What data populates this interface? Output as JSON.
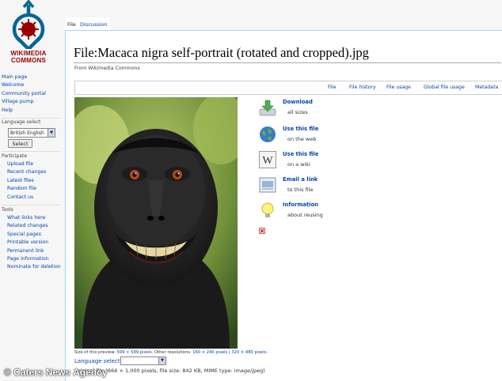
{
  "site": {
    "wordmark_line1": "WIKIMEDIA",
    "wordmark_line2": "COMMONS"
  },
  "sidebar": {
    "nav": [
      "Main page",
      "Welcome",
      "Community portal",
      "Village pump",
      "Help"
    ],
    "language": {
      "heading": "Language select",
      "selected": "British English",
      "button": "Select"
    },
    "participate": {
      "heading": "Participate",
      "items": [
        "Upload file",
        "Recent changes",
        "Latest files",
        "Random file",
        "Contact us"
      ]
    },
    "tools": {
      "heading": "Tools",
      "items": [
        "What links here",
        "Related changes",
        "Special pages",
        "Printable version",
        "Permanent link",
        "Page information",
        "Nominate for deletion"
      ]
    }
  },
  "tabs": {
    "file": "File",
    "discussion": "Discussion"
  },
  "page": {
    "title": "File:Macaca nigra self-portrait (rotated and cropped).jpg",
    "subtitle": "From Wikimedia Commons"
  },
  "filetoc": [
    "File",
    "File history",
    "File usage",
    "Global file usage",
    "Metadata"
  ],
  "actions": [
    {
      "label": "Download",
      "sub": "all sizes",
      "icon": "download-icon"
    },
    {
      "label": "Use this file",
      "sub": "on the web",
      "icon": "globe-icon"
    },
    {
      "label": "Use this file",
      "sub": "on a wiki",
      "icon": "wikipedia-icon"
    },
    {
      "label": "Email a link",
      "sub": "to this file",
      "icon": "email-icon"
    },
    {
      "label": "Information",
      "sub": "about reusing",
      "icon": "lightbulb-icon"
    }
  ],
  "preview": {
    "prefix": "Size of this preview: ",
    "size": "599 × 599 pixels",
    "others": ". Other resolutions: ",
    "res1": "160 × 240 pixels",
    "sep": " | ",
    "res2": "320 × 480 pixels",
    "end": "."
  },
  "content_language_label": "Language select:",
  "original_file": "Original file (666 × 1,000 pixels, file size: 842 KB, MIME type: image/jpeg)",
  "watermark": "© Caters News Agency",
  "colors": {
    "link": "#0645ad",
    "border": "#a7d7f9",
    "logo_red": "#990000",
    "logo_blue": "#006699"
  }
}
